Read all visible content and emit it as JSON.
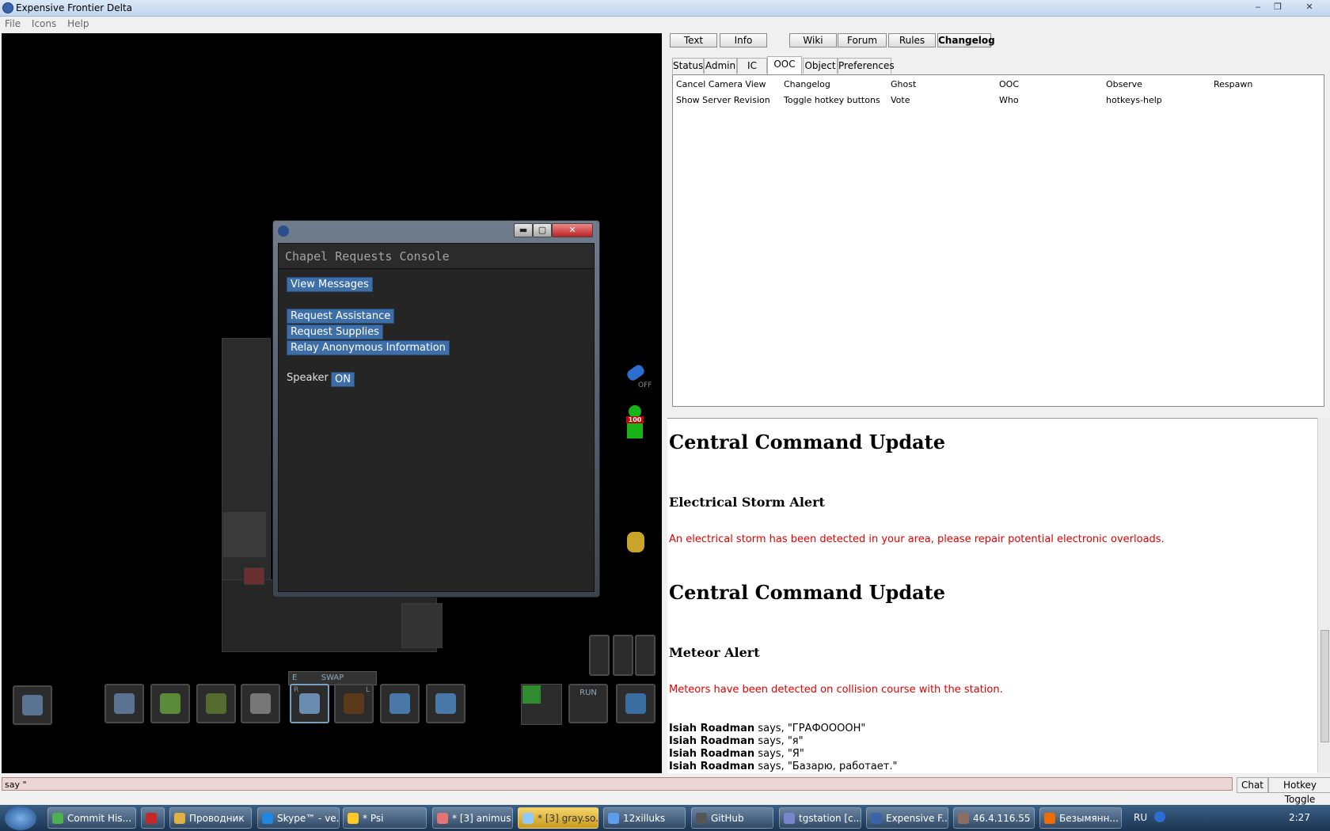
{
  "window": {
    "title": "Expensive Frontier Delta",
    "minimize": "‒",
    "maximize": "❐",
    "close": "✕"
  },
  "menu": [
    "File",
    "Icons",
    "Help"
  ],
  "popup": {
    "console_title": "Chapel Requests Console",
    "buttons": {
      "view_messages": "View Messages",
      "request_assistance": "Request Assistance",
      "request_supplies": "Request Supplies",
      "relay_anonymous": "Relay Anonymous Information"
    },
    "speaker_label": "Speaker",
    "speaker_state": "ON",
    "controls": {
      "min": "▬",
      "max": "▢",
      "close": "✕"
    }
  },
  "hud": {
    "health": "100",
    "internals": "OFF",
    "swap": "SWAP",
    "run": "RUN",
    "hand_left": "L",
    "hand_right": "R",
    "e_key": "E"
  },
  "top_buttons": [
    "Text",
    "Info",
    "Wiki",
    "Forum",
    "Rules",
    "Changelog"
  ],
  "tabs": [
    "Status",
    "Admin",
    "IC",
    "OOC",
    "Object",
    "Preferences"
  ],
  "active_tab": "OOC",
  "verbs": [
    [
      "Cancel Camera View",
      "Changelog",
      "Ghost",
      "OOC",
      "Observe",
      "Respawn"
    ],
    [
      "Show Server Revision",
      "Toggle hotkey buttons",
      "Vote",
      "Who",
      "hotkeys-help"
    ]
  ],
  "chat": {
    "update1_title": "Central Command Update",
    "alert1_title": "Electrical Storm Alert",
    "alert1_text": "An electrical storm has been detected in your area, please repair potential electronic overloads.",
    "update2_title": "Central Command Update",
    "alert2_title": "Meteor Alert",
    "alert2_text": "Meteors have been detected on collision course with the station.",
    "messages": [
      {
        "speaker": "Isiah Roadman",
        "verb": "says,",
        "text": "\"ГРАФООООН\""
      },
      {
        "speaker": "Isiah Roadman",
        "verb": "says,",
        "text": "\"я\""
      },
      {
        "speaker": "Isiah Roadman",
        "verb": "says,",
        "text": "\"Я\""
      },
      {
        "speaker": "Isiah Roadman",
        "verb": "says,",
        "text": "\"Базарю, работает.\""
      }
    ]
  },
  "input": {
    "value": "say \"",
    "chat_button": "Chat",
    "hotkey_button": "Hotkey Toggle"
  },
  "taskbar": {
    "items": [
      "Commit His...",
      "",
      "Проводник",
      "Skype™ - ve...",
      "* Psi",
      "* [3] animus...",
      "* [3] gray.so...",
      "12xilluks",
      "GitHub",
      "tgstation [c...",
      "Expensive F...",
      "46.4.116.55 ...",
      "Безымянн..."
    ],
    "active_index": 6,
    "lang": "RU",
    "time": "2:27"
  },
  "colors": {
    "accent_button": "#3e6ea8",
    "alert_red": "#e30000",
    "taskbar": "#1b3553"
  }
}
